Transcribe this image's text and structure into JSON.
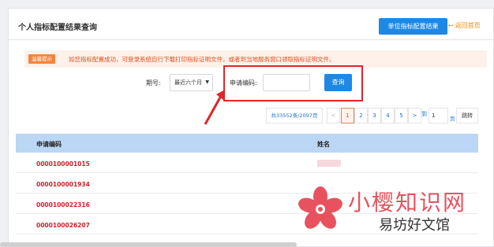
{
  "header": {
    "title": "个人指标配置结果查询",
    "config_button": "单位指标配置结果",
    "back_link": "返回首页"
  },
  "notice": {
    "tag": "温馨提示",
    "text": "如您指标配置成功，可登录系统自行下载打印指标证明文件，或者到当地服务窗口领取指标证明文件。"
  },
  "search": {
    "period_label": "期号:",
    "period_value": "最近六个月",
    "code_label": "申请编码:",
    "code_value": "",
    "search_button": "查询"
  },
  "pager": {
    "info": "共33552条/2097页",
    "prev": "<",
    "pages": [
      "1",
      "2",
      "3",
      "4",
      "5"
    ],
    "current_page": 1,
    "next": ">",
    "goto_prefix": "到",
    "goto_value": "1",
    "unit": "页",
    "jump_button": "跳转"
  },
  "table": {
    "columns": [
      "申请编码",
      "姓名"
    ],
    "rows": [
      {
        "code": "0000100001015",
        "name_redacted": true
      },
      {
        "code": "0000100001934",
        "name_redacted": true
      },
      {
        "code": "0000100022316",
        "name_redacted": true
      },
      {
        "code": "0000100026207",
        "name_redacted": true
      }
    ]
  },
  "watermark": {
    "line1": "小樱知识网",
    "line2": "易坊好文馆"
  },
  "colors": {
    "primary": "#1e88e5",
    "accent_orange": "#f28c00",
    "notice_red": "#e84c1c",
    "code_red": "#d0202a",
    "highlight_box": "#e0252a",
    "table_header": "#bcd7f5"
  }
}
